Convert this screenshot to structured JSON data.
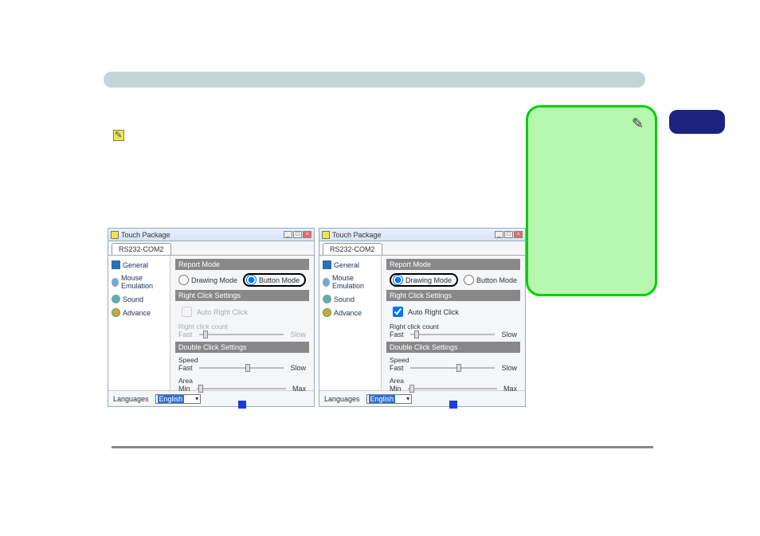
{
  "panel_title": "Touch Package",
  "tab_label": "RS232-COM2",
  "side": {
    "general": "General",
    "mouse": "Mouse Emulation",
    "sound": "Sound",
    "advance": "Advance"
  },
  "sections": {
    "report": "Report Mode",
    "rightclick": "Right Click Settings",
    "doubleclick": "Double Click Settings"
  },
  "radios": {
    "drawing": "Drawing Mode",
    "button": "Button Mode"
  },
  "rc": {
    "auto": "Auto Right Click",
    "count": "Right click count",
    "fast": "Fast",
    "slow": "Slow"
  },
  "dc": {
    "speed": "Speed",
    "fast": "Fast",
    "slow": "Slow",
    "area": "Area",
    "min": "Min",
    "max": "Max"
  },
  "languages_label": "Languages",
  "languages_value": "English"
}
